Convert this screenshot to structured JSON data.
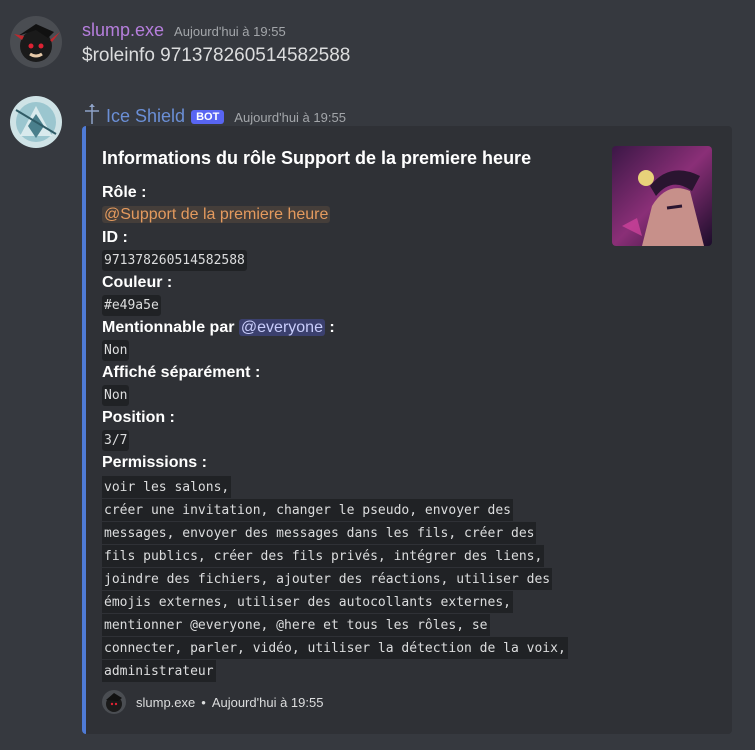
{
  "messages": [
    {
      "username": "slump.exe",
      "username_color": "#b57edc",
      "timestamp": "Aujourd'hui à 19:55",
      "content": "$roleinfo 971378260514582588"
    },
    {
      "username": "Ice Shield",
      "username_color": "#6b8fd6",
      "bot_tag": "BOT",
      "timestamp": "Aujourd'hui à 19:55"
    }
  ],
  "embed": {
    "accent_color": "#4f7bd6",
    "title": "Informations du rôle Support de la premiere heure",
    "fields": {
      "role_label": "Rôle :",
      "role_mention": "@Support de la premiere heure",
      "id_label": "ID :",
      "id_value": "971378260514582588",
      "couleur_label": "Couleur :",
      "couleur_value": "#e49a5e",
      "mention_label_prefix": "Mentionnable par",
      "mention_everyone": "@everyone",
      "mention_label_suffix": ":",
      "mention_value": "Non",
      "affiche_label": "Affiché séparément :",
      "affiche_value": "Non",
      "position_label": "Position :",
      "position_value": "3/7",
      "permissions_label": "Permissions :",
      "permissions_lines": [
        "voir les salons,",
        "créer une invitation, changer le pseudo, envoyer des",
        "messages, envoyer des messages dans les fils, créer des",
        "fils publics, créer des fils privés, intégrer des liens,",
        "joindre des fichiers, ajouter des réactions, utiliser des",
        "émojis externes, utiliser des autocollants externes,",
        "mentionner @everyone, @here et tous les rôles, se",
        "connecter, parler, vidéo, utiliser la détection de la voix,",
        "administrateur"
      ]
    },
    "footer": {
      "author": "slump.exe",
      "separator": "•",
      "timestamp": "Aujourd'hui à 19:55"
    }
  }
}
